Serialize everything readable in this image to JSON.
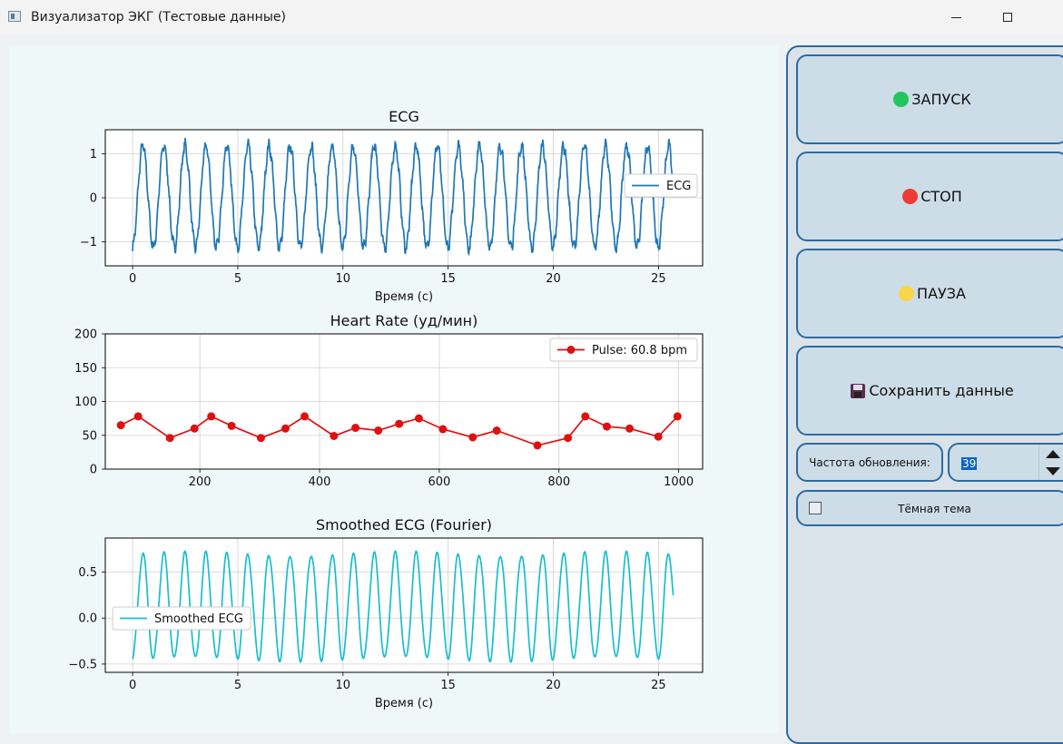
{
  "window": {
    "title": "Визуализатор ЭКГ (Тестовые данные)",
    "icon": "app-window-icon"
  },
  "controls": {
    "start_label": "ЗАПУСК",
    "stop_label": "СТОП",
    "pause_label": "ПАУЗА",
    "save_label": "Сохранить данные",
    "update_rate_label": "Частота обновления:",
    "update_rate_value": "39",
    "dark_theme_label": "Тёмная тема",
    "dark_theme_checked": false,
    "colors": {
      "start": "#22c55e",
      "stop": "#ef3b36",
      "pause": "#f9d548"
    }
  },
  "chart_data": [
    {
      "type": "line",
      "title": "ECG",
      "xlabel": "Время (с)",
      "ylabel": "",
      "xlim": [
        -1.3,
        27.1
      ],
      "ylim": [
        -1.55,
        1.55
      ],
      "xticks": [
        0,
        5,
        10,
        15,
        20,
        25
      ],
      "yticks": [
        -1,
        0,
        1
      ],
      "ytick_labels": [
        "−1",
        "0",
        "1"
      ],
      "grid": true,
      "legend_position": "center-right",
      "series": [
        {
          "name": "ECG",
          "color": "#1f77b4",
          "signal": "oscillation",
          "x_range": [
            0,
            25.7
          ],
          "period": 1.0,
          "amplitude_min": -1.3,
          "amplitude_max": 1.35
        }
      ]
    },
    {
      "type": "line",
      "title": "Heart Rate (уд/мин)",
      "xlabel": "",
      "ylabel": "",
      "xlim": [
        42,
        1040
      ],
      "ylim": [
        0,
        200
      ],
      "xticks": [
        200,
        400,
        600,
        800,
        1000
      ],
      "yticks": [
        0,
        50,
        100,
        150,
        200
      ],
      "grid": true,
      "legend_position": "top-right",
      "series": [
        {
          "name": "Pulse: 60.8 bpm",
          "color": "#e01010",
          "marker": "circle",
          "x": [
            68,
            97,
            150,
            191,
            219,
            253,
            302,
            343,
            375,
            424,
            460,
            498,
            533,
            566,
            606,
            656,
            696,
            764,
            815,
            844,
            880,
            918,
            966,
            998
          ],
          "y": [
            65,
            78,
            46,
            60,
            78,
            64,
            46,
            60,
            78,
            49,
            61,
            57,
            67,
            75,
            59,
            47,
            57,
            35,
            46,
            78,
            63,
            60,
            48,
            78
          ]
        }
      ]
    },
    {
      "type": "line",
      "title": "Smoothed ECG (Fourier)",
      "xlabel": "Время (с)",
      "ylabel": "",
      "xlim": [
        -1.3,
        27.1
      ],
      "ylim": [
        -0.59,
        0.87
      ],
      "xticks": [
        0,
        5,
        10,
        15,
        20,
        25
      ],
      "yticks": [
        -0.5,
        0.0,
        0.5
      ],
      "ytick_labels": [
        "−0.5",
        "0.0",
        "0.5"
      ],
      "grid": true,
      "legend_position": "center-left",
      "series": [
        {
          "name": "Smoothed ECG",
          "color": "#17becf",
          "signal": "oscillation",
          "x_range": [
            0,
            25.7
          ],
          "period": 1.0,
          "amplitude_min": -0.53,
          "amplitude_max": 0.78
        }
      ]
    }
  ]
}
